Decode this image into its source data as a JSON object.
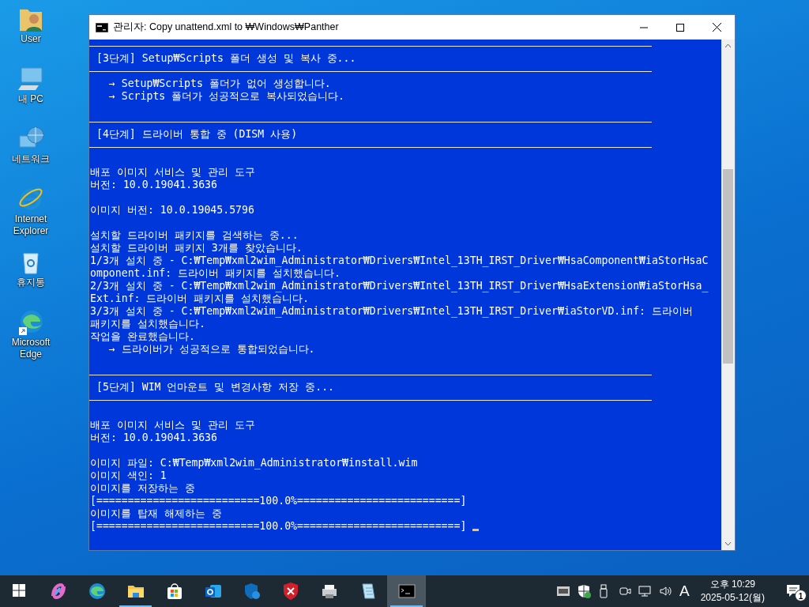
{
  "desktop_icons": [
    {
      "kind": "user",
      "label": "User"
    },
    {
      "kind": "pc",
      "label": "내 PC"
    },
    {
      "kind": "network",
      "label": "네트워크"
    },
    {
      "kind": "ie",
      "label": "Internet Explorer"
    },
    {
      "kind": "bin",
      "label": "휴지통"
    },
    {
      "kind": "edge",
      "label": "Microsoft Edge"
    }
  ],
  "window": {
    "title": "관리자: Copy unattend.xml to ₩Windows₩Panther"
  },
  "console": {
    "lines": [
      {
        "kind": "rule"
      },
      {
        "kind": "text",
        "text": " [3단계] Setup₩Scripts 폴더 생성 및 복사 중..."
      },
      {
        "kind": "rule"
      },
      {
        "kind": "text",
        "text": "   → Setup₩Scripts 폴더가 없어 생성합니다."
      },
      {
        "kind": "text",
        "text": "   → Scripts 폴더가 성공적으로 복사되었습니다."
      },
      {
        "kind": "blank"
      },
      {
        "kind": "rule"
      },
      {
        "kind": "text",
        "text": " [4단계] 드라이버 통합 중 (DISM 사용)"
      },
      {
        "kind": "rule"
      },
      {
        "kind": "blank"
      },
      {
        "kind": "text",
        "text": "배포 이미지 서비스 및 관리 도구"
      },
      {
        "kind": "text",
        "text": "버전: 10.0.19041.3636"
      },
      {
        "kind": "blank"
      },
      {
        "kind": "text",
        "text": "이미지 버전: 10.0.19045.5796"
      },
      {
        "kind": "blank"
      },
      {
        "kind": "text",
        "text": "설치할 드라이버 패키지를 검색하는 중..."
      },
      {
        "kind": "text",
        "text": "설치할 드라이버 패키지 3개를 찾았습니다."
      },
      {
        "kind": "text",
        "text": "1/3개 설치 중 - C:₩Temp₩xml2wim_Administrator₩Drivers₩Intel_13TH_IRST_Driver₩HsaComponent₩iaStorHsaC"
      },
      {
        "kind": "text",
        "text": "omponent.inf: 드라이버 패키지를 설치했습니다."
      },
      {
        "kind": "text",
        "text": "2/3개 설치 중 - C:₩Temp₩xml2wim_Administrator₩Drivers₩Intel_13TH_IRST_Driver₩HsaExtension₩iaStorHsa_"
      },
      {
        "kind": "text",
        "text": "Ext.inf: 드라이버 패키지를 설치했습니다."
      },
      {
        "kind": "text",
        "text": "3/3개 설치 중 - C:₩Temp₩xml2wim_Administrator₩Drivers₩Intel_13TH_IRST_Driver₩iaStorVD.inf: 드라이버"
      },
      {
        "kind": "text",
        "text": "패키지를 설치했습니다."
      },
      {
        "kind": "text",
        "text": "작업을 완료했습니다."
      },
      {
        "kind": "text",
        "text": "   → 드라이버가 성공적으로 통합되었습니다."
      },
      {
        "kind": "blank"
      },
      {
        "kind": "rule"
      },
      {
        "kind": "text",
        "text": " [5단계] WIM 언마운트 및 변경사항 저장 중..."
      },
      {
        "kind": "rule"
      },
      {
        "kind": "blank"
      },
      {
        "kind": "text",
        "text": "배포 이미지 서비스 및 관리 도구"
      },
      {
        "kind": "text",
        "text": "버전: 10.0.19041.3636"
      },
      {
        "kind": "blank"
      },
      {
        "kind": "text",
        "text": "이미지 파일: C:₩Temp₩xml2wim_Administrator₩install.wim"
      },
      {
        "kind": "text",
        "text": "이미지 색인: 1"
      },
      {
        "kind": "text",
        "text": "이미지를 저장하는 중"
      },
      {
        "kind": "text",
        "text": "[==========================100.0%==========================]"
      },
      {
        "kind": "text",
        "text": "이미지를 탑재 해제하는 중"
      },
      {
        "kind": "text",
        "text": "[==========================100.0%==========================]",
        "cursor": true
      }
    ]
  },
  "taskbar": {
    "apps": [
      {
        "kind": "start",
        "selected": false,
        "running": false
      },
      {
        "kind": "copilot",
        "selected": false,
        "running": false
      },
      {
        "kind": "edge",
        "selected": false,
        "running": false
      },
      {
        "kind": "folder",
        "selected": false,
        "running": true
      },
      {
        "kind": "store",
        "selected": false,
        "running": false
      },
      {
        "kind": "outlook",
        "selected": false,
        "running": false
      },
      {
        "kind": "shield",
        "selected": false,
        "running": false
      },
      {
        "kind": "xshield",
        "selected": false,
        "running": false
      },
      {
        "kind": "printer",
        "selected": false,
        "running": false
      },
      {
        "kind": "notepad",
        "selected": false,
        "running": false
      },
      {
        "kind": "console",
        "selected": true,
        "running": true
      }
    ]
  },
  "tray": {
    "input_indicator": "A",
    "time": "오후 10:29",
    "date": "2025-05-12(월)",
    "notification_count": "1"
  }
}
